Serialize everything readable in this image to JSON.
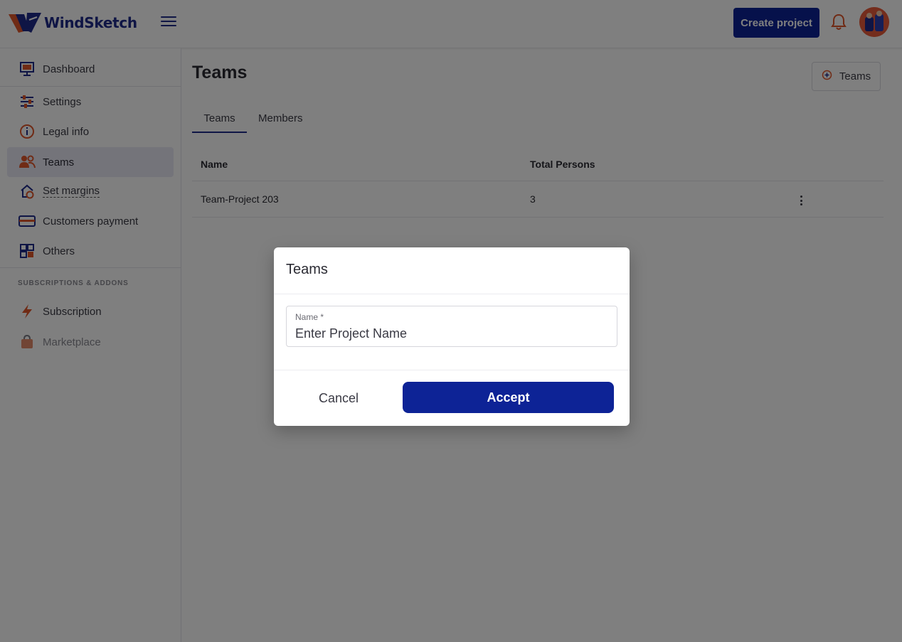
{
  "header": {
    "app_name": "WindSketch",
    "create_label": "Create project"
  },
  "sidebar": {
    "items": [
      {
        "label": "Dashboard"
      },
      {
        "label": "Settings"
      },
      {
        "label": "Legal info"
      },
      {
        "label": "Teams"
      },
      {
        "label": "Set margins"
      },
      {
        "label": "Customers payment"
      },
      {
        "label": "Others"
      }
    ],
    "section_label": "SUBSCRIPTIONS & ADDONS",
    "addons": [
      {
        "label": "Subscription"
      },
      {
        "label": "Marketplace"
      }
    ]
  },
  "main": {
    "title": "Teams",
    "add_button_label": "Teams",
    "tabs": [
      {
        "label": "Teams"
      },
      {
        "label": "Members"
      }
    ],
    "table": {
      "headers": [
        "Name",
        "Total Persons"
      ],
      "rows": [
        [
          "Team-Project 203",
          "3"
        ]
      ]
    }
  },
  "dialog": {
    "title": "Teams",
    "field_label": "Name *",
    "field_placeholder": "Enter Project Name",
    "cancel_label": "Cancel",
    "accept_label": "Accept"
  },
  "colors": {
    "brand_navy": "#0d2396",
    "accent_orange": "#e0562b"
  }
}
